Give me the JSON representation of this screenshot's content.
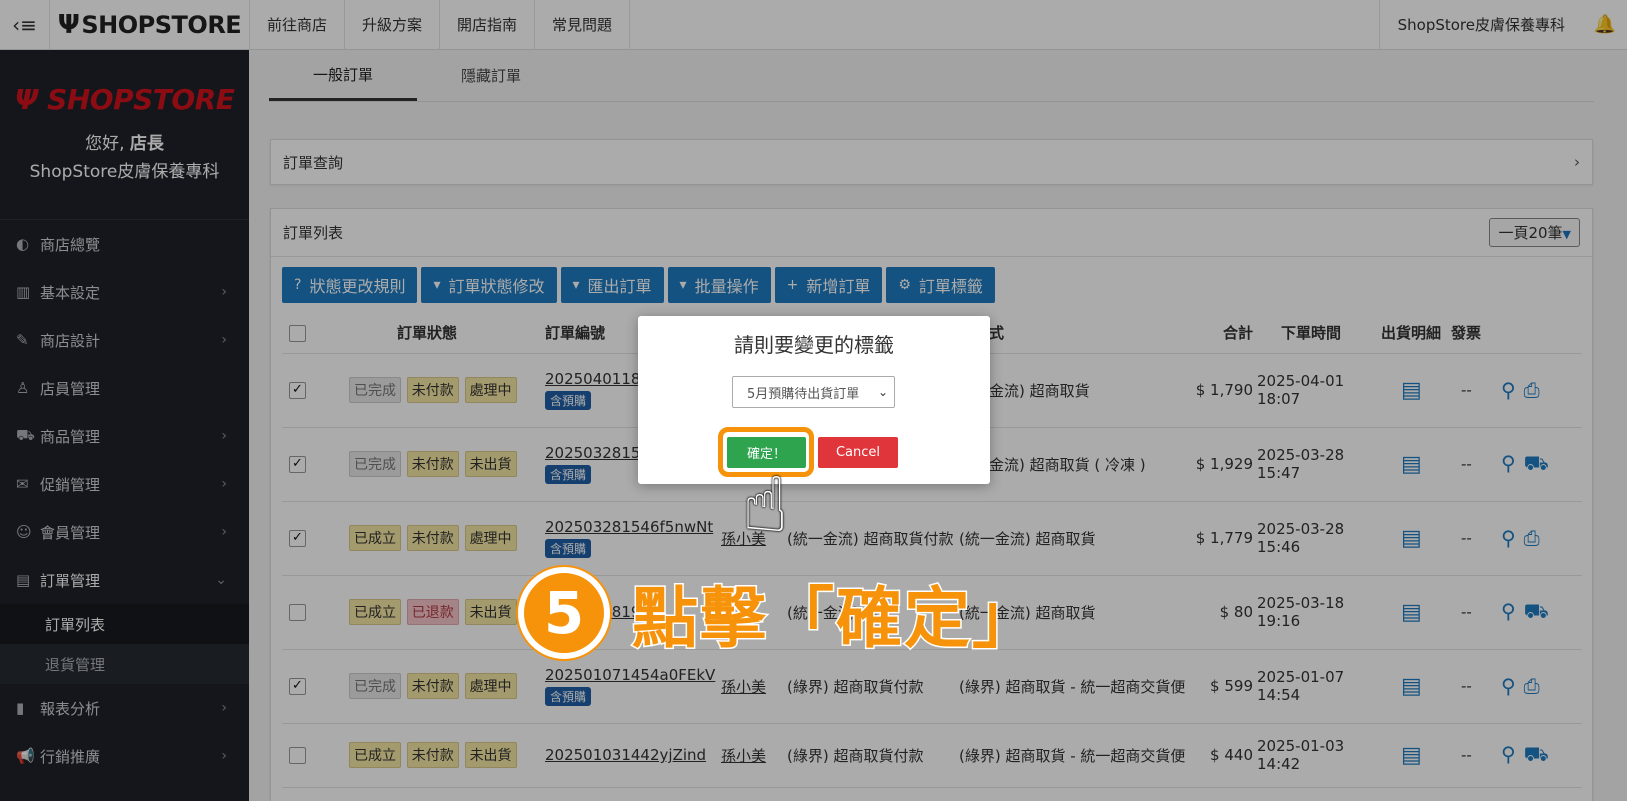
{
  "topbar": {
    "menu_icon": "‹≡",
    "logo": "SHOPSTORE",
    "nav": [
      "前往商店",
      "升級方案",
      "開店指南",
      "常見問題"
    ],
    "store_name": "ShopStore皮膚保養專科",
    "bell_icon": "bell-icon"
  },
  "sidebar": {
    "logo": "SHOPSTORE",
    "greeting_prefix": "您好,",
    "greeting_role": "店長",
    "store_name": "ShopStore皮膚保養專科",
    "items": [
      {
        "label": "商店總覽",
        "icon": "◐"
      },
      {
        "label": "基本設定",
        "icon": "▥"
      },
      {
        "label": "商店設計",
        "icon": "✎"
      },
      {
        "label": "店員管理",
        "icon": "♙"
      },
      {
        "label": "商品管理",
        "icon": "⛟"
      },
      {
        "label": "促銷管理",
        "icon": "✉"
      },
      {
        "label": "會員管理",
        "icon": "☺"
      },
      {
        "label": "訂單管理",
        "icon": "▤"
      }
    ],
    "sub_items": [
      "訂單列表",
      "退貨管理"
    ],
    "bottom_items": [
      {
        "label": "報表分析",
        "icon": "▮"
      },
      {
        "label": "行銷推廣",
        "icon": "📢"
      }
    ]
  },
  "tabs": [
    "一般訂單",
    "隱藏訂單"
  ],
  "query_panel": {
    "title": "訂單查詢"
  },
  "list_panel": {
    "title": "訂單列表",
    "per_page": "一頁20筆"
  },
  "toolbar": [
    {
      "label": "狀態更改規則",
      "icon": "?"
    },
    {
      "label": "訂單狀態修改",
      "icon": "▾"
    },
    {
      "label": "匯出訂單",
      "icon": "▾"
    },
    {
      "label": "批量操作",
      "icon": "▾"
    },
    {
      "label": "新增訂單",
      "icon": "+"
    },
    {
      "label": "訂單標籤",
      "icon": "⚙"
    }
  ],
  "table": {
    "headers": [
      "訂單狀態",
      "訂單編號",
      "",
      "",
      "貨方式",
      "合計",
      "下單時間",
      "出貨明細",
      "發票"
    ],
    "rows": [
      {
        "checked": true,
        "s1": "已完成",
        "s2": "未付款",
        "s3": "處理中",
        "no": "20250401180",
        "pre": "含預購",
        "buyer": "",
        "pay": "",
        "ship": "統一金流) 超商取貨",
        "total": "$ 1,790",
        "time": "2025-04-01 18:07",
        "inv": "--"
      },
      {
        "checked": true,
        "s1": "已完成",
        "s2": "未付款",
        "s3": "未出貨",
        "no": "20250328154",
        "pre": "含預購",
        "buyer": "",
        "pay": "",
        "ship": "統一金流) 超商取貨 ( 冷凍 )",
        "total": "$ 1,929",
        "time": "2025-03-28 15:47",
        "inv": "--"
      },
      {
        "checked": true,
        "s1": "已成立",
        "s2": "未付款",
        "s3": "處理中",
        "no": "202503281546f5nwNt",
        "pre": "含預購",
        "buyer": "孫小美",
        "pay": "(統一金流) 超商取貨付款",
        "ship": "(統一金流) 超商取貨",
        "total": "$ 1,779",
        "time": "2025-03-28 15:46",
        "inv": "--"
      },
      {
        "checked": false,
        "s1": "已成立",
        "s2": "已退款",
        "s3": "未出貨",
        "no": "20250318191",
        "pre": "",
        "buyer": "",
        "pay": "(統一金流) 信",
        "ship": "(統一金流) 超商取貨",
        "total": "$ 80",
        "time": "2025-03-18 19:16",
        "inv": "--"
      },
      {
        "checked": true,
        "s1": "已完成",
        "s2": "未付款",
        "s3": "處理中",
        "no": "202501071454a0FEkV",
        "pre": "含預購",
        "buyer": "孫小美",
        "pay": "(綠界) 超商取貨付款",
        "ship": "(綠界) 超商取貨 - 統一超商交貨便",
        "total": "$ 599",
        "time": "2025-01-07 14:54",
        "inv": "--"
      },
      {
        "checked": false,
        "s1": "已成立",
        "s2": "未付款",
        "s3": "未出貨",
        "no": "202501031442yjZind",
        "pre": "",
        "buyer": "孫小美",
        "pay": "(綠界) 超商取貨付款",
        "ship": "(綠界) 超商取貨 - 統一超商交貨便",
        "total": "$ 440",
        "time": "2025-01-03 14:42",
        "inv": "--"
      }
    ]
  },
  "modal": {
    "title": "請則要變更的標籤",
    "selected_option": "5月預購待出貨訂單",
    "confirm_label": "確定！",
    "cancel_label": "Cancel"
  },
  "annotation": {
    "step": "5",
    "text": "點擊「確定」"
  },
  "colors": {
    "primary": "#1f7bc1",
    "sidebar": "#1f2229",
    "confirm": "#2ea44f",
    "cancel": "#e0353a",
    "highlight": "#f7930a"
  }
}
